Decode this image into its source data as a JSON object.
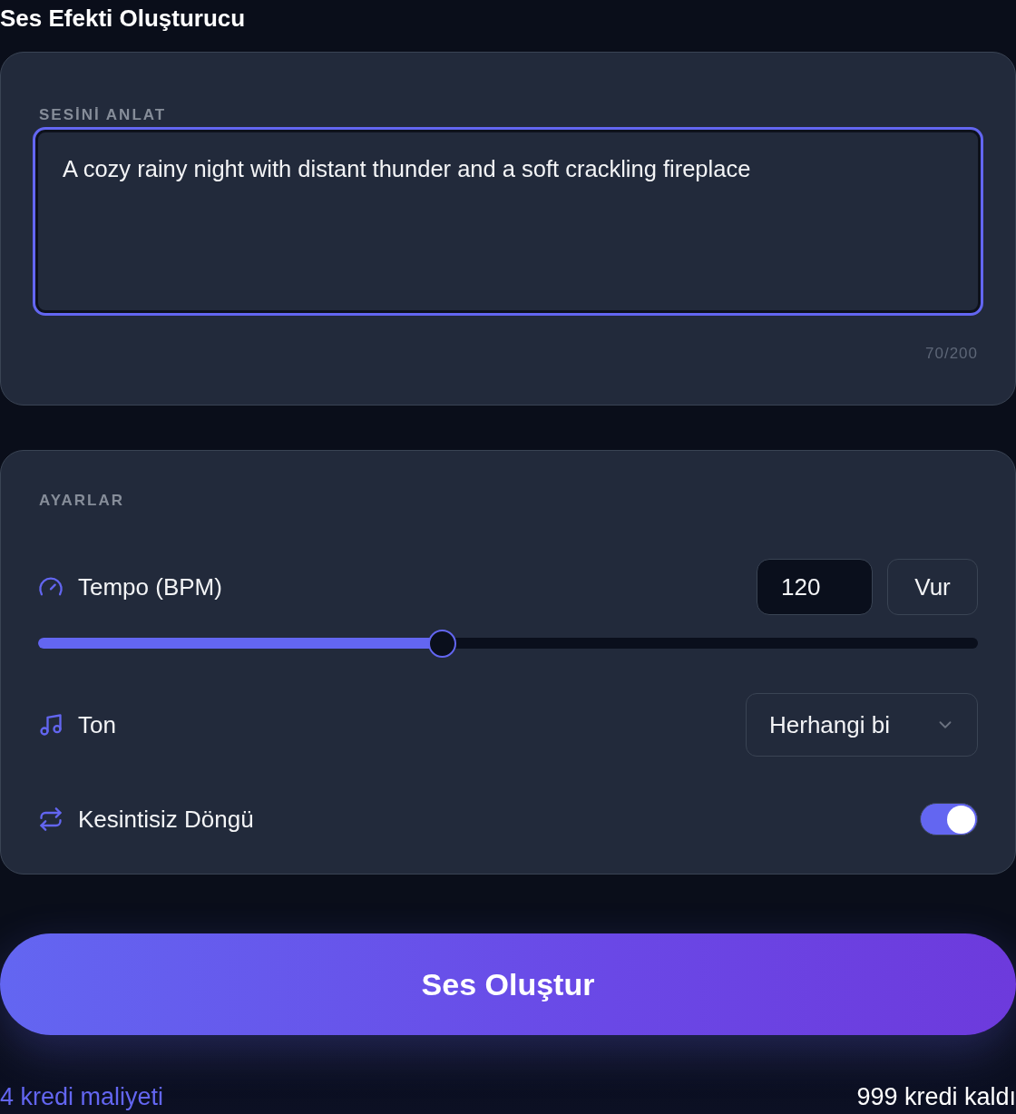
{
  "title": "Ses Efekti Oluşturucu",
  "description": {
    "label": "SESİNİ ANLAT",
    "value": "A cozy rainy night with distant thunder and a soft crackling fireplace",
    "focused": true,
    "counter": "70/200"
  },
  "settings": {
    "label": "AYARLAR",
    "rows": [
      {
        "kind": "tempo",
        "label": "Tempo (BPM)",
        "value": "120",
        "button": "Vur",
        "level": 0.43
      },
      {
        "kind": "select",
        "label": "Ton",
        "value": "Herhangi bi"
      },
      {
        "kind": "toggle",
        "label": "Kesintisiz Döngü",
        "on": true
      }
    ]
  },
  "generate_button": "Ses Oluştur",
  "footer": {
    "cost": "4 kredi maliyeti",
    "remaining": "999 kredi kaldı"
  }
}
